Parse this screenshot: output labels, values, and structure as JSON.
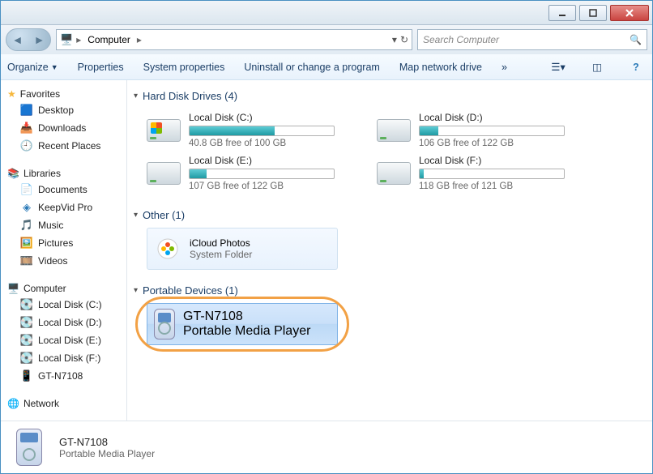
{
  "breadcrumb": {
    "root": "Computer"
  },
  "search": {
    "placeholder": "Search Computer"
  },
  "toolbar": {
    "organize": "Organize",
    "properties": "Properties",
    "system_properties": "System properties",
    "uninstall": "Uninstall or change a program",
    "map_drive": "Map network drive"
  },
  "sidebar": {
    "favorites": {
      "label": "Favorites",
      "items": [
        "Desktop",
        "Downloads",
        "Recent Places"
      ]
    },
    "libraries": {
      "label": "Libraries",
      "items": [
        "Documents",
        "KeepVid Pro",
        "Music",
        "Pictures",
        "Videos"
      ]
    },
    "computer": {
      "label": "Computer",
      "items": [
        "Local Disk (C:)",
        "Local Disk (D:)",
        "Local Disk (E:)",
        "Local Disk (F:)",
        "GT-N7108"
      ]
    },
    "network": {
      "label": "Network"
    }
  },
  "sections": {
    "hdd": {
      "heading": "Hard Disk Drives (4)"
    },
    "other": {
      "heading": "Other (1)"
    },
    "portable": {
      "heading": "Portable Devices (1)"
    }
  },
  "drives": [
    {
      "name": "Local Disk (C:)",
      "free": "40.8 GB free of 100 GB",
      "fill_pct": 59
    },
    {
      "name": "Local Disk (D:)",
      "free": "106 GB free of 122 GB",
      "fill_pct": 13
    },
    {
      "name": "Local Disk (E:)",
      "free": "107 GB free of 122 GB",
      "fill_pct": 12
    },
    {
      "name": "Local Disk (F:)",
      "free": "118 GB free of 121 GB",
      "fill_pct": 3
    }
  ],
  "other_item": {
    "name": "iCloud Photos",
    "sub": "System Folder"
  },
  "portable_item": {
    "name": "GT-N7108",
    "sub": "Portable Media Player"
  },
  "details": {
    "title": "GT-N7108",
    "sub": "Portable Media Player"
  }
}
